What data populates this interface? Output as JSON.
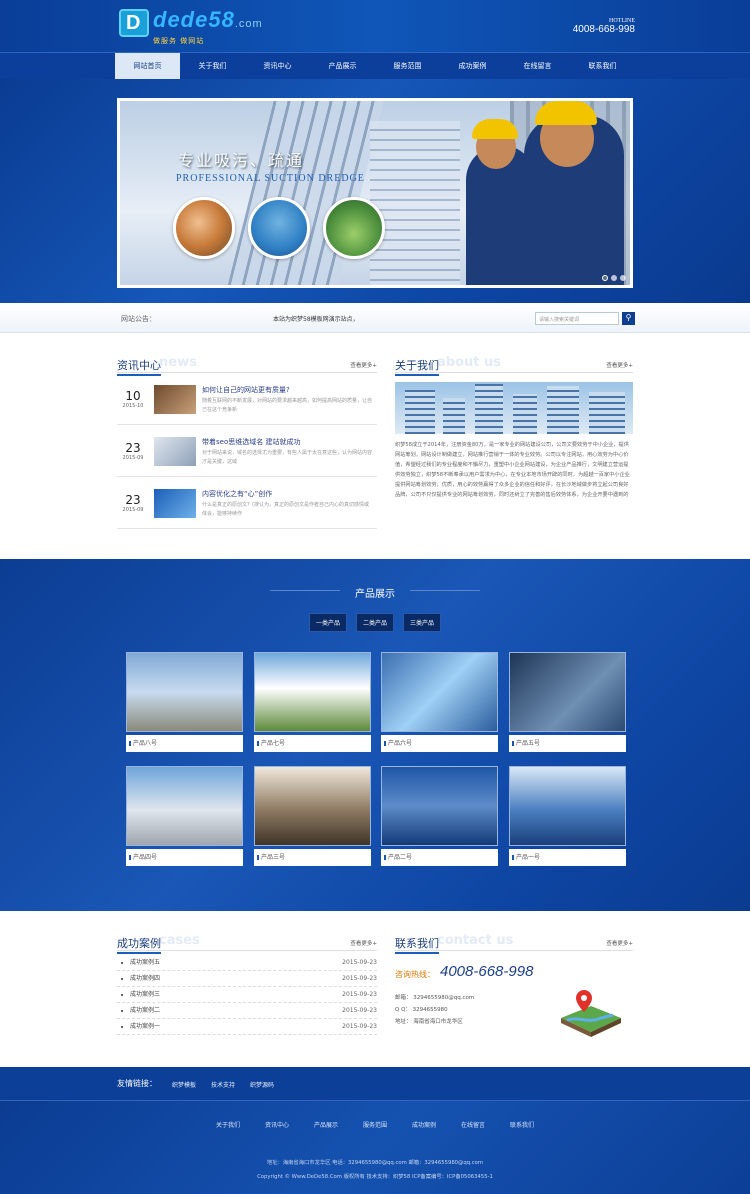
{
  "header": {
    "logo_main": "dede58",
    "logo_domain": ".com",
    "logo_sub": "做服务 做网站",
    "hotline_label": "HOTLINE",
    "hotline_number": "4008-668-998"
  },
  "nav": [
    "网站首页",
    "关于我们",
    "资讯中心",
    "产品展示",
    "服务范围",
    "成功案例",
    "在线留言",
    "联系我们"
  ],
  "banner": {
    "title": "专业吸污、疏通",
    "subtitle": "PROFESSIONAL SUCTION DREDGE"
  },
  "notice": {
    "label": "网站公告：",
    "text": "本站为织梦58模板网演示站点，",
    "search_placeholder": "请输入搜索关键词"
  },
  "news": {
    "title": "资讯中心",
    "ghost": "news",
    "more": "查看更多+",
    "items": [
      {
        "day": "10",
        "ym": "2015-10",
        "title": "如何让自己的网站更有质量?",
        "desc": "随着互联网的不断发展，对网站的要求越来越高，如何提高网站的质量，让自己在这个竞争新"
      },
      {
        "day": "23",
        "ym": "2015-09",
        "title": "带着seo思维选域名 建站就成功",
        "desc": "对于网站来说，域名的选择尤为重要，有些人属于太在意这些，认为网站内容才是关键，这域"
      },
      {
        "day": "23",
        "ym": "2015-09",
        "title": "内容优化之有“心”创作",
        "desc": "什么是真正的原创文？(搜认为，真正的原创文是作者自己内心的真切感情或体会，能够持续作"
      }
    ]
  },
  "about": {
    "title": "关于我们",
    "ghost": "about us",
    "more": "查看更多+",
    "text": "织梦58成立于2014年，注册资金80万，是一家专业的网站建设公司，公司文要效劳于中小企业，提供网站筹划，网站设计制做建立，网站推行营销于一体的专业效劳。公司以专注网站，用心效劳为中心价值，希望经过我们的专业程度和不懈尽力，重塑中小企业网站建设，为企业产品推行，文明建立营运提供效劳独立，织梦58不断奉承以用户需求为中心，在专业本地市场开辟的同时，为超越一百家中小企业提供网站筹划效劳，优质，用心的效劳赢得了众多企业的信任和好评，在长沙地域做步将立起公司良好品牌，公司不只仅提供专业的网站筹划效劳，同时还树立了完善的售后效劳体系，为企业开要中遇到的"
  },
  "products": {
    "title": "产品展示",
    "tabs": [
      "一类产品",
      "二类产品",
      "三类产品"
    ],
    "items": [
      "产品八号",
      "产品七号",
      "产品六号",
      "产品五号",
      "产品四号",
      "产品三号",
      "产品二号",
      "产品一号"
    ]
  },
  "cases": {
    "title": "成功案例",
    "ghost": "cases",
    "more": "查看更多+",
    "items": [
      {
        "name": "成功案例五",
        "date": "2015-09-23"
      },
      {
        "name": "成功案例四",
        "date": "2015-09-23"
      },
      {
        "name": "成功案例三",
        "date": "2015-09-23"
      },
      {
        "name": "成功案例二",
        "date": "2015-09-23"
      },
      {
        "name": "成功案例一",
        "date": "2015-09-23"
      }
    ]
  },
  "contact": {
    "title": "联系我们",
    "ghost": "contact us",
    "more": "查看更多+",
    "hot_label": "咨询热线：",
    "hot_number": "4008-668-998",
    "email": "邮箱：  3294655980@qq.com",
    "qq": "Q Q：  3294655980",
    "address": "地址：  海南省海口市龙华区"
  },
  "friends": {
    "label": "友情链接：",
    "links": [
      "织梦模板",
      "技术支持",
      "织梦源码"
    ]
  },
  "footer": {
    "nav": [
      "关于我们",
      "资讯中心",
      "产品展示",
      "服务范围",
      "成功案例",
      "在线留言",
      "联系我们"
    ],
    "line1": "地址：海南省海口市龙华区   电话：3294655980@qq.com   邮箱：3294655980@qq.com",
    "line2": "Copyright © Www.DeDe58.Com 版权所有  技术支持：织梦58  ICP备案编号：ICP备05063455-1"
  }
}
